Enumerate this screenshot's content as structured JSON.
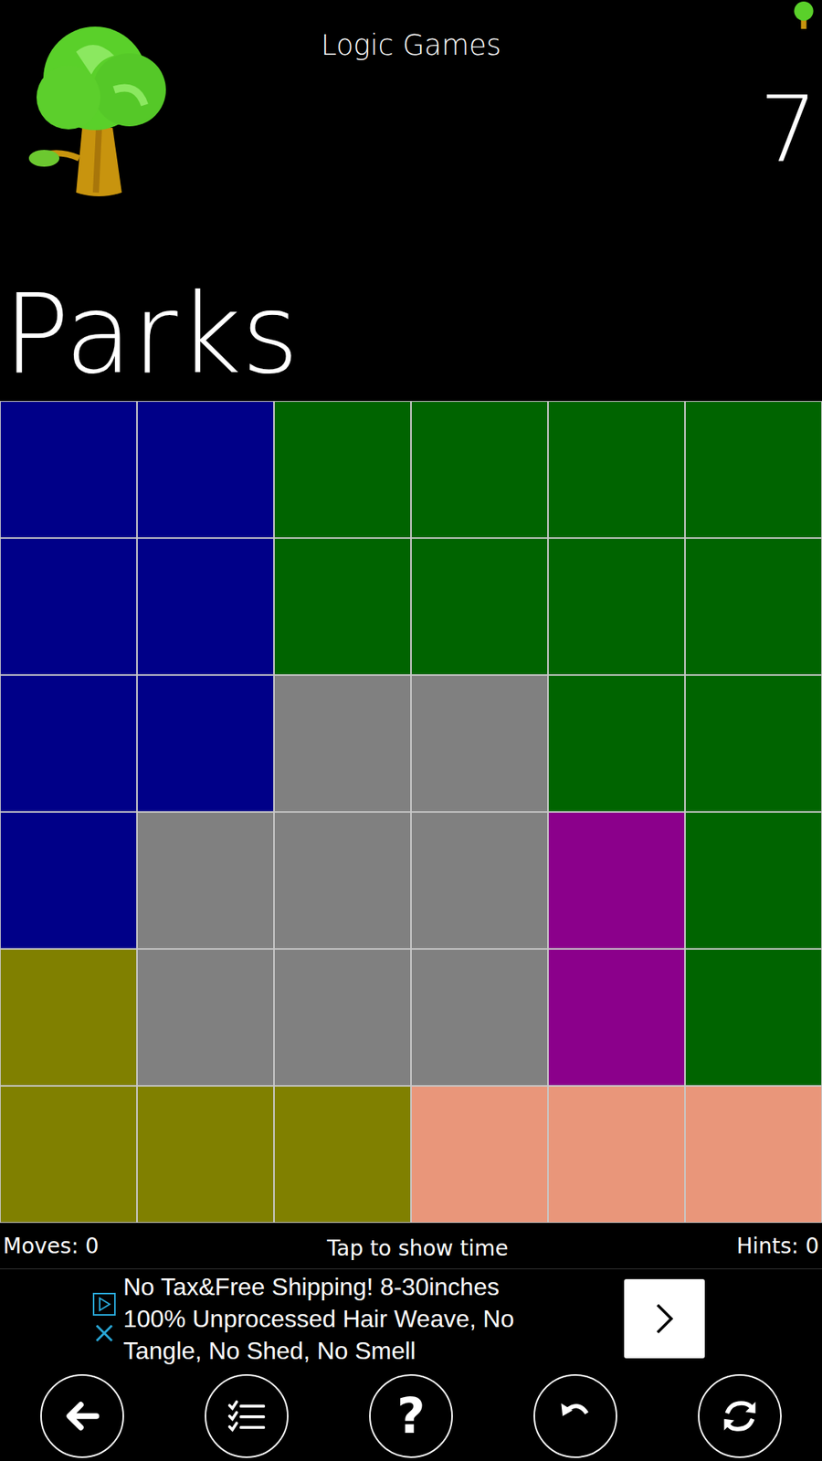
{
  "header": {
    "app_title": "Logic Games",
    "level_number": "7"
  },
  "puzzle": {
    "title": "Parks",
    "grid": [
      [
        {
          "color": "#000088"
        },
        {
          "color": "#000088"
        },
        {
          "color": "#006400"
        },
        {
          "color": "#006400"
        },
        {
          "color": "#006400"
        },
        {
          "color": "#006400"
        }
      ],
      [
        {
          "color": "#000088"
        },
        {
          "color": "#000088"
        },
        {
          "color": "#006400"
        },
        {
          "color": "#006400"
        },
        {
          "color": "#006400"
        },
        {
          "color": "#006400"
        }
      ],
      [
        {
          "color": "#000088"
        },
        {
          "color": "#000088"
        },
        {
          "color": "#808080"
        },
        {
          "color": "#808080"
        },
        {
          "color": "#006400"
        },
        {
          "color": "#006400"
        }
      ],
      [
        {
          "color": "#000088"
        },
        {
          "color": "#808080"
        },
        {
          "color": "#808080"
        },
        {
          "color": "#808080"
        },
        {
          "color": "#8b008b"
        },
        {
          "color": "#006400"
        }
      ],
      [
        {
          "color": "#808000"
        },
        {
          "color": "#808080"
        },
        {
          "color": "#808080"
        },
        {
          "color": "#808080"
        },
        {
          "color": "#8b008b"
        },
        {
          "color": "#006400"
        }
      ],
      [
        {
          "color": "#808000"
        },
        {
          "color": "#808000"
        },
        {
          "color": "#808000"
        },
        {
          "color": "#e9967a"
        },
        {
          "color": "#e9967a"
        },
        {
          "color": "#e9967a"
        }
      ]
    ]
  },
  "status_bar": {
    "moves": "Moves: 0",
    "timer": "Tap to show time",
    "hints": "Hints: 0"
  },
  "ad": {
    "lines": [
      "No Tax&Free Shipping! 8-30inches",
      "100% Unprocessed Hair Weave, No",
      "Tangle, No Shed, No Smell"
    ]
  },
  "toolbar": {
    "help": "?"
  }
}
